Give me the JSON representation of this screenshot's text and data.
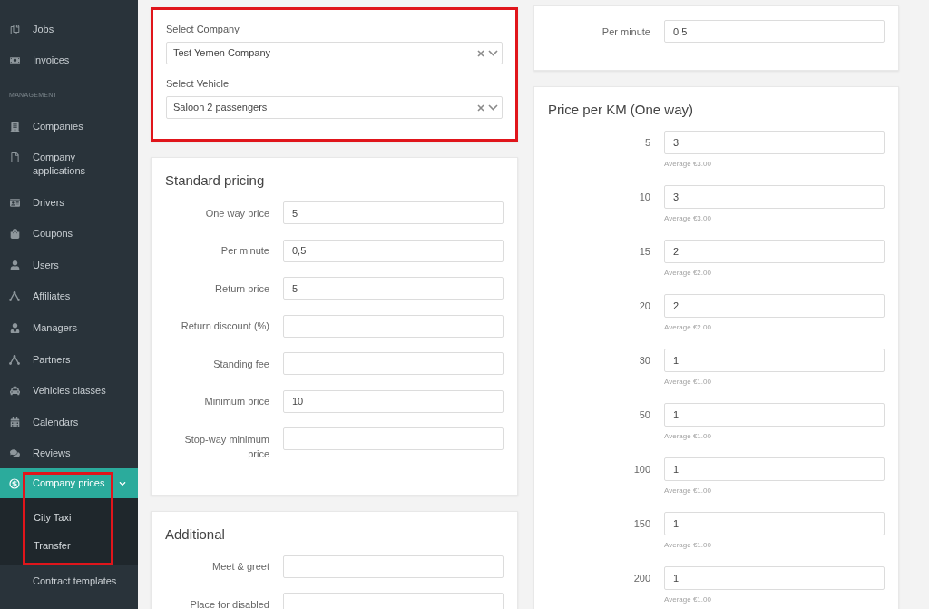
{
  "sidebar": {
    "items": [
      {
        "kind": "link",
        "label": "Jobs",
        "selected": false
      },
      {
        "kind": "link",
        "label": "Invoices",
        "selected": false
      },
      {
        "kind": "heading",
        "label": "MANAGEMENT"
      },
      {
        "kind": "link",
        "label": "Companies",
        "selected": false
      },
      {
        "kind": "link",
        "label": "Company applications",
        "selected": false
      },
      {
        "kind": "link",
        "label": "Drivers",
        "selected": false
      },
      {
        "kind": "link",
        "label": "Coupons",
        "selected": false
      },
      {
        "kind": "link",
        "label": "Users",
        "selected": false
      },
      {
        "kind": "link",
        "label": "Affiliates",
        "selected": false
      },
      {
        "kind": "link",
        "label": "Managers",
        "selected": false
      },
      {
        "kind": "link",
        "label": "Partners",
        "selected": false
      },
      {
        "kind": "link",
        "label": "Vehicles classes",
        "selected": false
      },
      {
        "kind": "link",
        "label": "Calendars",
        "selected": false
      },
      {
        "kind": "link",
        "label": "Reviews",
        "selected": false
      },
      {
        "kind": "group",
        "label": "Company prices",
        "selected": true,
        "expanded": true,
        "highlighted": true,
        "children": [
          {
            "label": "City Taxi",
            "selected": false
          },
          {
            "label": "Transfer",
            "selected": false
          }
        ]
      },
      {
        "kind": "link",
        "label": "Contract templates",
        "selected": false
      }
    ]
  },
  "selectors": {
    "highlighted": true,
    "fields": [
      {
        "label": "Select Company",
        "value": "Test Yemen Company"
      },
      {
        "label": "Select Vehicle",
        "value": "Saloon 2 passengers"
      }
    ]
  },
  "standard_pricing": {
    "title": "Standard pricing",
    "fields": [
      {
        "label": "One way price",
        "value": "5"
      },
      {
        "label": "Per minute",
        "value": "0,5"
      },
      {
        "label": "Return price",
        "value": "5"
      },
      {
        "label": "Return discount (%)"
      },
      {
        "label": "Standing fee"
      },
      {
        "label": "Minimum price",
        "value": "10"
      },
      {
        "label": "Stop-way minimum price"
      }
    ]
  },
  "additional": {
    "title": "Additional",
    "fields": [
      {
        "label": "Meet & greet"
      },
      {
        "label": "Place for disabled"
      }
    ]
  },
  "rate_card": {
    "fields": [
      {
        "label": "Per minute",
        "value": "0,5"
      }
    ]
  },
  "price_per_km": {
    "title": "Price per KM (One way)",
    "rows": [
      {
        "label": "5",
        "value": "3",
        "hint": "Average €3.00"
      },
      {
        "label": "10",
        "value": "3",
        "hint": "Average €3.00"
      },
      {
        "label": "15",
        "value": "2",
        "hint": "Average €2.00"
      },
      {
        "label": "20",
        "value": "2",
        "hint": "Average €2.00"
      },
      {
        "label": "30",
        "value": "1",
        "hint": "Average €1.00"
      },
      {
        "label": "50",
        "value": "1",
        "hint": "Average €1.00"
      },
      {
        "label": "100",
        "value": "1",
        "hint": "Average €1.00"
      },
      {
        "label": "150",
        "value": "1",
        "hint": "Average €1.00"
      },
      {
        "label": "200",
        "value": "1",
        "hint": "Average €1.00"
      }
    ]
  }
}
